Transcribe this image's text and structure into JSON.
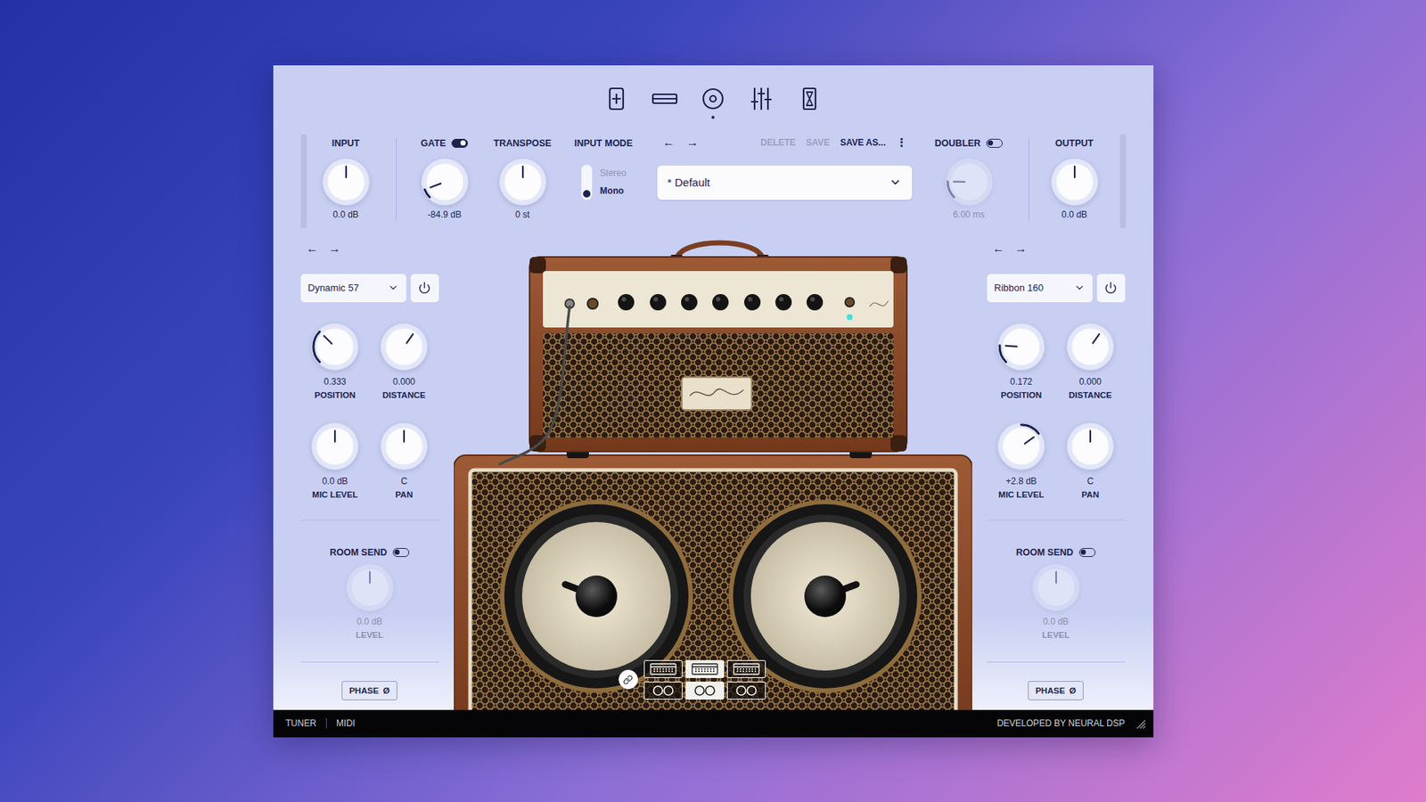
{
  "nav": [
    {
      "selected": false
    },
    {
      "selected": false
    },
    {
      "selected": true
    },
    {
      "selected": false
    },
    {
      "selected": false
    }
  ],
  "header": {
    "meters": [
      {
        "level": 0
      },
      {
        "level": 0
      }
    ],
    "input": {
      "label": "INPUT",
      "value": "0.0 dB",
      "level": 0.5,
      "kind": "bipolar"
    },
    "gate": {
      "label": "GATE",
      "on": true,
      "value": "-84.9 dB",
      "level": 0.09,
      "kind": "unipolar"
    },
    "transpose": {
      "label": "TRANSPOSE",
      "value": "0 st",
      "level": 0.5,
      "kind": "bipolar"
    },
    "input_mode": {
      "label": "INPUT MODE",
      "options": [
        {
          "label": "Stereo",
          "selected": false
        },
        {
          "label": "Mono",
          "selected": true
        }
      ]
    },
    "preset": {
      "prev": "←",
      "next": "→",
      "actions": [
        {
          "label": "DELETE",
          "disabled": true
        },
        {
          "label": "SAVE",
          "disabled": true
        },
        {
          "label": "SAVE AS...",
          "disabled": false
        }
      ],
      "more": "⋮",
      "name": "* Default"
    },
    "doubler": {
      "label": "DOUBLER",
      "on": false,
      "value": "6.00 ms",
      "level": 0.17,
      "kind": "unipolar"
    },
    "output": {
      "label": "OUTPUT",
      "value": "0.0 dB",
      "level": 0.5,
      "kind": "bipolar"
    }
  },
  "mics": [
    {
      "prev": "←",
      "next": "→",
      "model": "Dynamic 57",
      "on": true,
      "knobs": [
        {
          "label": "POSITION",
          "value": "0.333",
          "level": 0.333,
          "kind": "unipolar"
        },
        {
          "label": "DISTANCE",
          "value": "0.000",
          "level": 0.63,
          "kind": "plain"
        },
        {
          "label": "MIC LEVEL",
          "value": "0.0 dB",
          "level": 0.5,
          "kind": "bipolar"
        },
        {
          "label": "PAN",
          "value": "C",
          "level": 0.5,
          "kind": "bipolar"
        }
      ],
      "room_send": {
        "label": "ROOM SEND",
        "on": false,
        "value": "0.0 dB",
        "level_label": "LEVEL",
        "level": 0.5,
        "kind": "bipolar"
      },
      "phase": {
        "label": "PHASE",
        "icon": "Ø",
        "on": false
      }
    },
    {
      "prev": "←",
      "next": "→",
      "model": "Ribbon 160",
      "on": true,
      "knobs": [
        {
          "label": "POSITION",
          "value": "0.172",
          "level": 0.18,
          "kind": "unipolar"
        },
        {
          "label": "DISTANCE",
          "value": "0.000",
          "level": 0.63,
          "kind": "plain"
        },
        {
          "label": "MIC LEVEL",
          "value": "+2.8 dB",
          "level": 0.7,
          "kind": "bipolar"
        },
        {
          "label": "PAN",
          "value": "C",
          "level": 0.5,
          "kind": "bipolar"
        }
      ],
      "room_send": {
        "label": "ROOM SEND",
        "on": false,
        "value": "0.0 dB",
        "level_label": "LEVEL",
        "level": 0.5,
        "kind": "bipolar"
      },
      "phase": {
        "label": "PHASE",
        "icon": "Ø",
        "on": false
      }
    }
  ],
  "linked": true,
  "amp_selector": [
    {
      "selected": false
    },
    {
      "selected": true
    },
    {
      "selected": false
    }
  ],
  "cab_selector": [
    {
      "selected": false
    },
    {
      "selected": true
    },
    {
      "selected": false
    }
  ],
  "footer": {
    "items": [
      "TUNER",
      "MIDI"
    ],
    "credit": "DEVELOPED BY NEURAL DSP"
  }
}
